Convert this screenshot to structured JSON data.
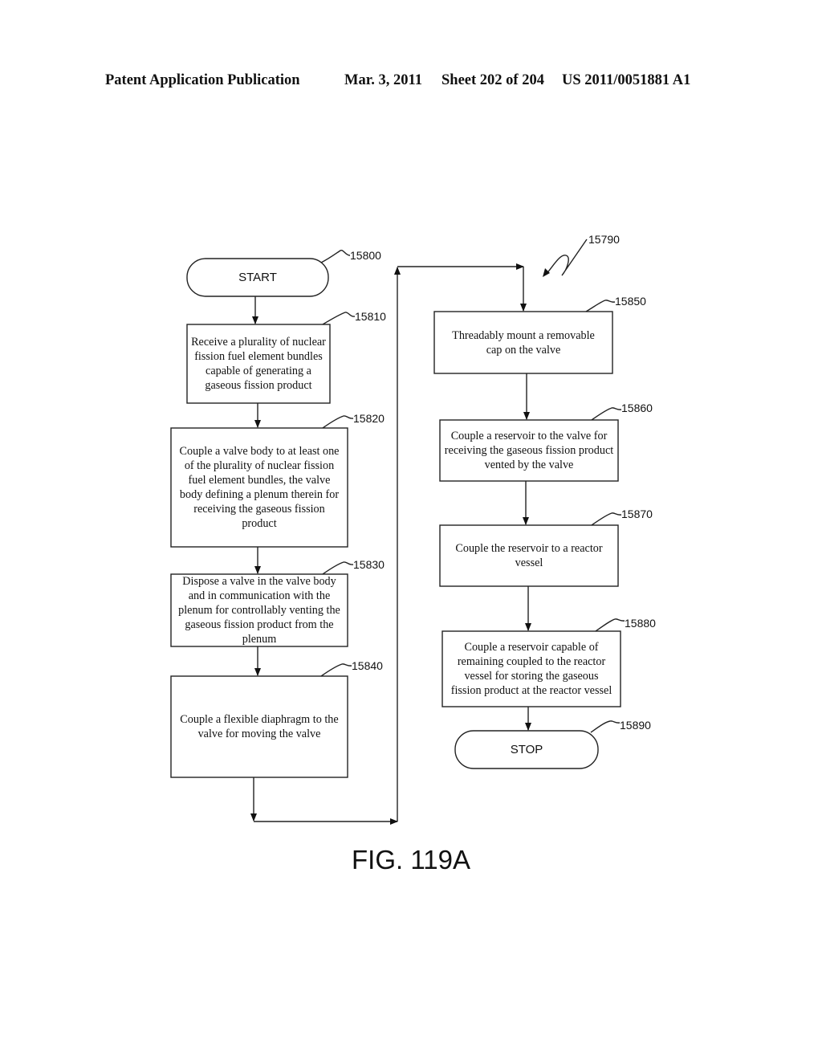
{
  "header": {
    "publication": "Patent Application Publication",
    "date": "Mar. 3, 2011",
    "sheet": "Sheet 202 of 204",
    "number": "US 2011/0051881 A1"
  },
  "figure": {
    "label": "FIG. 119A",
    "ref": "15790"
  },
  "nodes": [
    {
      "id": "15800",
      "type": "terminal",
      "text": "START"
    },
    {
      "id": "15810",
      "type": "process",
      "text": "Receive a plurality of nuclear fission fuel element bundles capable of generating a gaseous fission product"
    },
    {
      "id": "15820",
      "type": "process",
      "text": "Couple a valve body to at least one of the plurality of nuclear fission fuel element bundles, the valve body defining a plenum therein for receiving the gaseous fission product"
    },
    {
      "id": "15830",
      "type": "process",
      "text": "Dispose a valve in the valve body and in communication with the plenum for controllably venting the gaseous fission product from the plenum"
    },
    {
      "id": "15840",
      "type": "process",
      "text": "Couple a flexible diaphragm to the valve for moving the valve"
    },
    {
      "id": "15850",
      "type": "process",
      "text": "Threadably mount a removable cap on the valve"
    },
    {
      "id": "15860",
      "type": "process",
      "text": "Couple a reservoir to the valve for receiving the gaseous fission product vented by the valve"
    },
    {
      "id": "15870",
      "type": "process",
      "text": "Couple the reservoir to a reactor vessel"
    },
    {
      "id": "15880",
      "type": "process",
      "text": "Couple a reservoir capable of remaining coupled to the reactor vessel for storing the gaseous fission product at the reactor vessel"
    },
    {
      "id": "15890",
      "type": "terminal",
      "text": "STOP"
    }
  ],
  "edges": [
    {
      "from": "15800",
      "to": "15810"
    },
    {
      "from": "15810",
      "to": "15820"
    },
    {
      "from": "15820",
      "to": "15830"
    },
    {
      "from": "15830",
      "to": "15840"
    },
    {
      "from": "15840",
      "to": "15850"
    },
    {
      "from": "15850",
      "to": "15860"
    },
    {
      "from": "15860",
      "to": "15870"
    },
    {
      "from": "15870",
      "to": "15880"
    },
    {
      "from": "15880",
      "to": "15890"
    }
  ]
}
